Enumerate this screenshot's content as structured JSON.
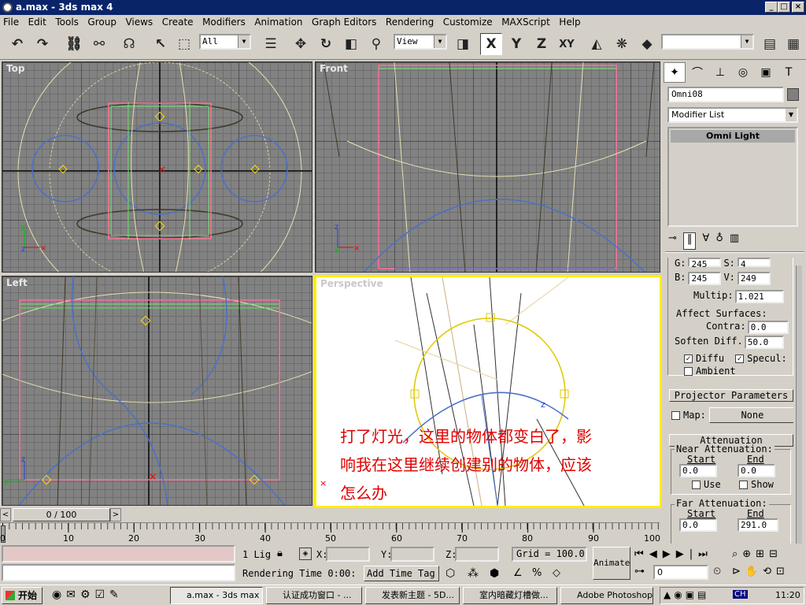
{
  "window": {
    "title": "a.max - 3ds max 4",
    "min": "_",
    "max": "□",
    "close": "×"
  },
  "menu": [
    "File",
    "Edit",
    "Tools",
    "Group",
    "Views",
    "Create",
    "Modifiers",
    "Animation",
    "Graph Editors",
    "Rendering",
    "Customize",
    "MAXScript",
    "Help"
  ],
  "toolbar": {
    "selection_filter": "All",
    "ref_coord": "View",
    "axis_x": "X",
    "axis_y": "Y",
    "axis_z": "Z",
    "axis_xy": "XY",
    "named_selection": ""
  },
  "viewports": {
    "top": "Top",
    "front": "Front",
    "left": "Left",
    "perspective": "Perspective"
  },
  "annotation": {
    "line1": "打了灯光，这里的物体都变白了，影",
    "line2": "响我在这里继续创建别的物体，应该",
    "line3": "怎么办"
  },
  "command_panel": {
    "object_name": "Omni08",
    "modifier_list": "Modifier List",
    "stack_item": "Omni Light",
    "color_row1": {
      "label_g": "G:",
      "value_g": "245",
      "label_s": "S:",
      "value_s": "4"
    },
    "color_row2": {
      "label_b": "B:",
      "value_b": "245",
      "label_v": "V:",
      "value_v": "249"
    },
    "multiplier_label": "Multip:",
    "multiplier_value": "1.021",
    "affect_surfaces": "Affect Surfaces:",
    "contrast_label": "Contra:",
    "contrast_value": "0.0",
    "soften_label": "Soften Diff.",
    "soften_value": "50.0",
    "diffuse_label": "Diffu",
    "specular_label": "Specul:",
    "ambient_label": "Ambient",
    "projector_title": "Projector Parameters",
    "map_label": "Map:",
    "map_value": "None",
    "attenuation_title": "Attenuation Parameters",
    "near_atten": "Near Attenuation:",
    "near_start_label": "Start",
    "near_end_label": "End",
    "near_start": "0.0",
    "near_end": "0.0",
    "near_use": "Use",
    "near_show": "Show",
    "far_atten": "Far Attenuation:",
    "far_start_label": "Start",
    "far_end_label": "End",
    "far_start": "0.0",
    "far_end": "291.0"
  },
  "timeline": {
    "frame": "0 / 100",
    "prev": "<",
    "next": ">"
  },
  "ruler_ticks": [
    "0",
    "10",
    "20",
    "30",
    "40",
    "50",
    "60",
    "70",
    "80",
    "90",
    "100"
  ],
  "status": {
    "selected": "1 Lig",
    "x_label": "X:",
    "y_label": "Y:",
    "z_label": "Z:",
    "grid": "Grid = 100.0",
    "animate": "Animate",
    "prompt": "Rendering Time  0:00:",
    "add_time_tag": "Add Time Tag",
    "frame_field": "0"
  },
  "taskbar": {
    "start": "开始",
    "tasks": [
      "a.max - 3ds max 4",
      "认证成功窗口 - ...",
      "发表新主题 - 5D...",
      "室内暗藏灯槽做...",
      "Adobe Photoshop"
    ],
    "clock": "11:20",
    "ime": "CH"
  }
}
